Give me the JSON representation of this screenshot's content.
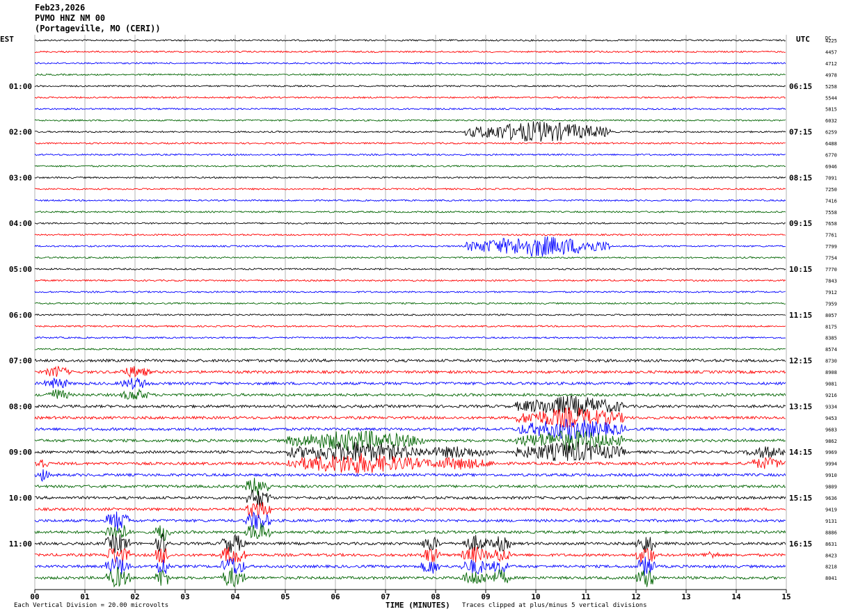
{
  "header": {
    "date": "Feb23,2026",
    "station": "PVMO HNZ NM 00",
    "location": "(Portageville, MO (CERI))"
  },
  "labels": {
    "left_zone": "EST",
    "right_zone": "UTC",
    "dc": "DC"
  },
  "footer": {
    "scale_note": "Each Vertical Division = 20.00 microvolts",
    "clip_note": "Traces clipped at plus/minus 5 vertical divisions"
  },
  "colors": {
    "trace_cycle": [
      "#000000",
      "#ff0000",
      "#0000ff",
      "#006400"
    ],
    "grid": "#808080"
  },
  "chart_data": {
    "type": "line",
    "title": "PVMO HNZ NM 00",
    "xlabel": "TIME (MINUTES)",
    "xlim": [
      0,
      15
    ],
    "x_ticks": [
      "00",
      "01",
      "02",
      "03",
      "04",
      "05",
      "06",
      "07",
      "08",
      "09",
      "10",
      "11",
      "12",
      "13",
      "14",
      "15"
    ],
    "rows": 48,
    "row_interval_minutes": 15,
    "left_time_labels": [
      {
        "row": 4,
        "label": "01:00"
      },
      {
        "row": 8,
        "label": "02:00"
      },
      {
        "row": 12,
        "label": "03:00"
      },
      {
        "row": 16,
        "label": "04:00"
      },
      {
        "row": 20,
        "label": "05:00"
      },
      {
        "row": 24,
        "label": "06:00"
      },
      {
        "row": 28,
        "label": "07:00"
      },
      {
        "row": 32,
        "label": "08:00"
      },
      {
        "row": 36,
        "label": "09:00"
      },
      {
        "row": 40,
        "label": "10:00"
      },
      {
        "row": 44,
        "label": "11:00"
      }
    ],
    "right_time_labels": [
      {
        "row": 4,
        "label": "06:15"
      },
      {
        "row": 8,
        "label": "07:15"
      },
      {
        "row": 12,
        "label": "08:15"
      },
      {
        "row": 16,
        "label": "09:15"
      },
      {
        "row": 20,
        "label": "10:15"
      },
      {
        "row": 24,
        "label": "11:15"
      },
      {
        "row": 28,
        "label": "12:15"
      },
      {
        "row": 32,
        "label": "13:15"
      },
      {
        "row": 36,
        "label": "14:15"
      },
      {
        "row": 40,
        "label": "15:15"
      },
      {
        "row": 44,
        "label": "16:15"
      }
    ],
    "dc_offsets": [
      4225,
      4457,
      4712,
      4978,
      5258,
      5544,
      5815,
      6032,
      6259,
      6488,
      6770,
      6946,
      7091,
      7250,
      7416,
      7558,
      7658,
      7761,
      7799,
      7754,
      7770,
      7843,
      7912,
      7959,
      8057,
      8175,
      8385,
      8574,
      8730,
      8908,
      9081,
      9216,
      9334,
      9453,
      9683,
      9862,
      9969,
      9994,
      9910,
      9809,
      9636,
      9419,
      9131,
      8886,
      8631,
      8423,
      8218,
      8041
    ],
    "events": [
      {
        "rows": [
          8,
          18
        ],
        "start_min": 8.6,
        "end_min": 11.5,
        "amp": 5,
        "note": "clipped"
      },
      {
        "rows": [
          29,
          30,
          31
        ],
        "start_min": 0.2,
        "end_min": 0.7,
        "amp": 3
      },
      {
        "rows": [
          29,
          30,
          31
        ],
        "start_min": 1.7,
        "end_min": 2.3,
        "amp": 3
      },
      {
        "rows": [
          32,
          33,
          34,
          35,
          36
        ],
        "start_min": 9.6,
        "end_min": 11.8,
        "amp": 5
      },
      {
        "rows": [
          35,
          36,
          37
        ],
        "start_min": 5.0,
        "end_min": 7.8,
        "amp": 5
      },
      {
        "rows": [
          36,
          37
        ],
        "start_min": 7.6,
        "end_min": 9.2,
        "amp": 3
      },
      {
        "rows": [
          36,
          37
        ],
        "start_min": 14.2,
        "end_min": 15,
        "amp": 3
      },
      {
        "rows": [
          37,
          38
        ],
        "start_min": 0,
        "end_min": 0.3,
        "amp": 3
      },
      {
        "rows": [
          39,
          40,
          41,
          42,
          43
        ],
        "start_min": 4.2,
        "end_min": 4.7,
        "amp": 5
      },
      {
        "rows": [
          42,
          43,
          44,
          45,
          46,
          47
        ],
        "start_min": 1.4,
        "end_min": 1.9,
        "amp": 5
      },
      {
        "rows": [
          43,
          44,
          45,
          46,
          47
        ],
        "start_min": 2.4,
        "end_min": 2.7,
        "amp": 5
      },
      {
        "rows": [
          44,
          45,
          46,
          47
        ],
        "start_min": 3.7,
        "end_min": 4.2,
        "amp": 5
      },
      {
        "rows": [
          44,
          45,
          46
        ],
        "start_min": 7.7,
        "end_min": 8.1,
        "amp": 4
      },
      {
        "rows": [
          44,
          45,
          46,
          47
        ],
        "start_min": 8.5,
        "end_min": 9.1,
        "amp": 4
      },
      {
        "rows": [
          44,
          45,
          46,
          47
        ],
        "start_min": 9.1,
        "end_min": 9.5,
        "amp": 4
      },
      {
        "rows": [
          44,
          45,
          46,
          47
        ],
        "start_min": 12.0,
        "end_min": 12.4,
        "amp": 5
      },
      {
        "rows": [
          45
        ],
        "start_min": 13.3,
        "end_min": 13.7,
        "amp": 2
      }
    ]
  }
}
